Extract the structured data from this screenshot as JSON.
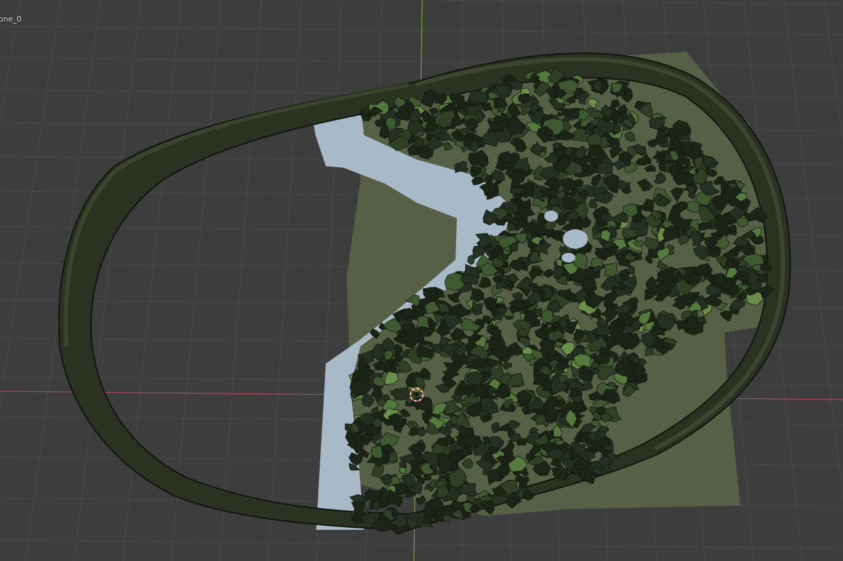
{
  "viewport": {
    "object_label": "one_0",
    "background_color": "#3d3d3d",
    "grid_color": "#4a4a4a",
    "x_axis_color": "#b8535e",
    "y_axis_color": "#7fb33a",
    "water_color": "#a8bac8",
    "ground_color": "#545e44",
    "ring_color": "#2b3222",
    "foliage_colors": [
      "#1c2417",
      "#243021",
      "#2f4027",
      "#3f5a31",
      "#557a3e",
      "#6a8f4a"
    ]
  }
}
